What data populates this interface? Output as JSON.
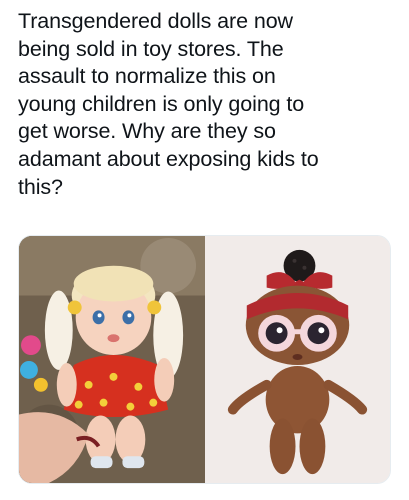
{
  "post": {
    "text_lines": [
      "Transgendered dolls are now",
      "being sold in toy stores. The",
      "assault to normalize this on",
      "young children is only going to",
      "get worse. Why are they so",
      "adamant about exposing kids to",
      "this?"
    ]
  },
  "media": {
    "photos": [
      {
        "subject": "blonde-doll-in-red-polka-dot-dress"
      },
      {
        "subject": "dark-skinned-doll-with-red-headband-and-glasses"
      }
    ]
  }
}
